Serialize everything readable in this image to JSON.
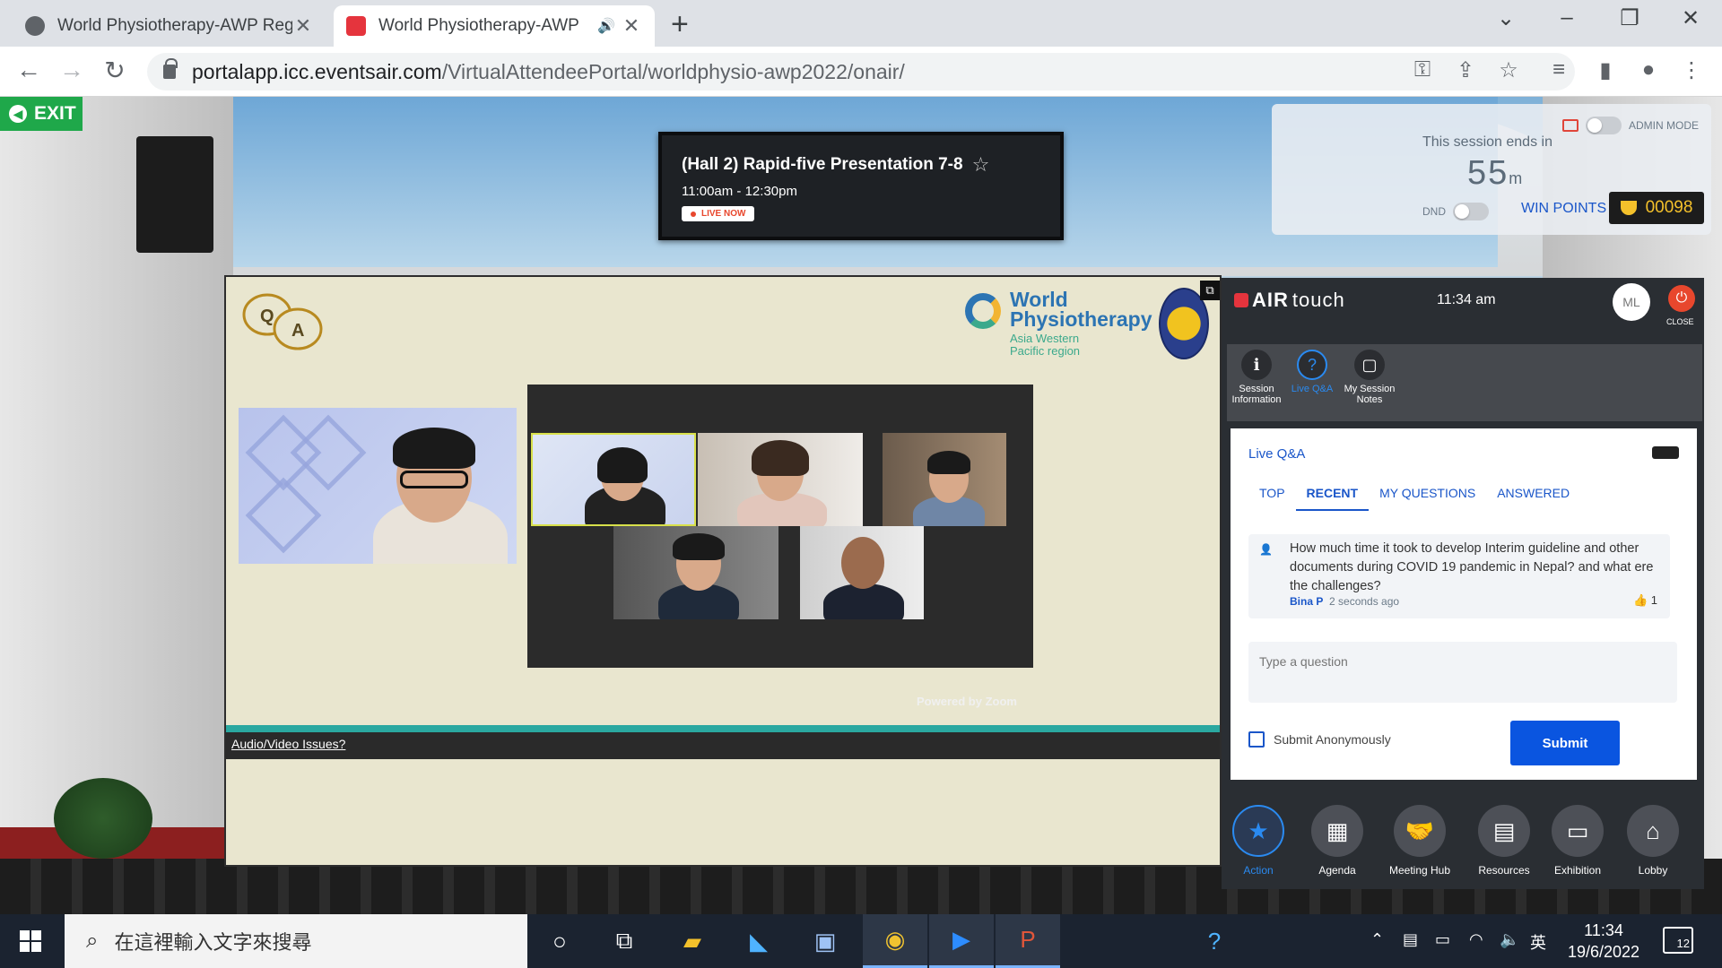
{
  "browser": {
    "tabs": [
      {
        "title": "World Physiotherapy-AWP Reg",
        "active": false
      },
      {
        "title": "World Physiotherapy-AWP",
        "active": true
      }
    ],
    "url_host": "portalapp.icc.eventsair.com",
    "url_path": "/VirtualAttendeePortal/worldphysio-awp2022/onair/"
  },
  "exit_label": "EXIT",
  "session": {
    "title": "(Hall 2) Rapid-five Presentation 7-8",
    "time": "11:00am - 12:30pm",
    "live_badge": "LIVE NOW"
  },
  "timer": {
    "admin_mode": "ADMIN MODE",
    "ends_label": "This session ends in",
    "minutes": "55",
    "minutes_unit": "m",
    "dnd": "DND",
    "win_points_label": "WIN POINTS",
    "points": "00098"
  },
  "slide": {
    "qa_q": "Q",
    "qa_a": "A",
    "logo_line1": "World",
    "logo_line2": "Physiotherapy",
    "logo_sub1": "Asia Western",
    "logo_sub2": "Pacific region",
    "powered_by": "Powered by Zoom",
    "av_issues": "Audio/Video Issues?"
  },
  "airtouch": {
    "brand_bold": "AIR",
    "brand_light": "touch",
    "clock": "11:34 am",
    "avatar": "ML",
    "close": "CLOSE",
    "actions": [
      {
        "label": "Session Information",
        "icon": "info-icon"
      },
      {
        "label": "Live Q&A",
        "icon": "qa-icon",
        "active": true
      },
      {
        "label": "My Session Notes",
        "icon": "notes-icon"
      }
    ],
    "qa": {
      "header": "Live Q&A",
      "tabs": [
        "TOP",
        "RECENT",
        "MY QUESTIONS",
        "ANSWERED"
      ],
      "active_tab": "RECENT",
      "question": {
        "text": "How much time it took to develop Interim guideline and other documents during COVID 19 pandemic in Nepal? and what ere the challenges?",
        "author": "Bina P",
        "time": "2 seconds ago",
        "likes": "1"
      },
      "input_placeholder": "Type a question",
      "anonymous_label": "Submit Anonymously",
      "submit_label": "Submit"
    },
    "dock": [
      {
        "label": "Action",
        "icon": "star-icon",
        "active": true
      },
      {
        "label": "Agenda",
        "icon": "calendar-icon"
      },
      {
        "label": "Meeting Hub",
        "icon": "handshake-icon"
      },
      {
        "label": "Resources",
        "icon": "resources-icon"
      },
      {
        "label": "Exhibition",
        "icon": "monitor-icon"
      },
      {
        "label": "Lobby",
        "icon": "home-icon"
      }
    ]
  },
  "taskbar": {
    "search_placeholder": "在這裡輸入文字來搜尋",
    "ime": "英",
    "time": "11:34",
    "date": "19/6/2022",
    "notifications": "12"
  },
  "colors": {
    "accent_blue": "#1a56c9",
    "live_red": "#e8472d",
    "exit_green": "#1fa84a",
    "points_gold": "#f4c12b"
  }
}
